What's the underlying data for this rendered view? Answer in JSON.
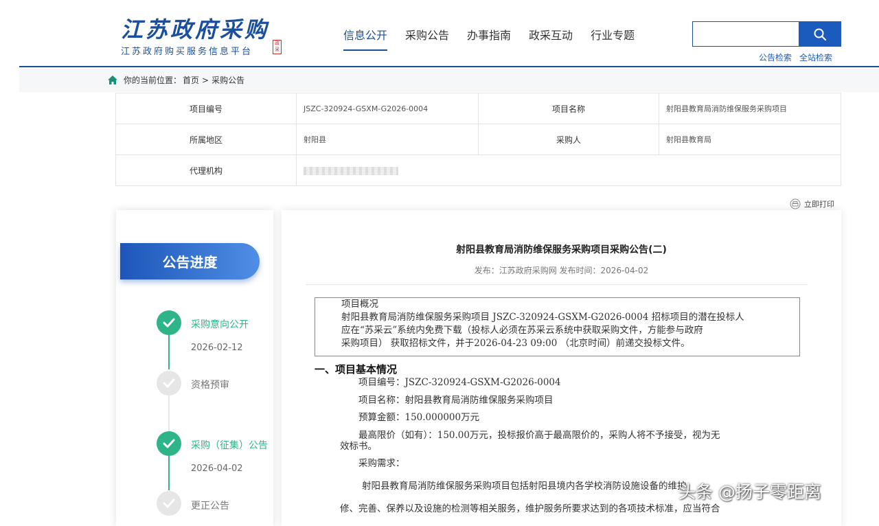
{
  "header": {
    "logo_calligraphy": "江苏政府采购",
    "logo_subtitle": "江苏政府购买服务信息平台",
    "logo_seal": "政采",
    "nav": [
      "信息公开",
      "采购公告",
      "办事指南",
      "政采互动",
      "行业专题"
    ],
    "search_placeholder": "",
    "search_links": [
      "公告检索",
      "全站检索"
    ]
  },
  "breadcrumb": {
    "prefix": "你的当前位置：",
    "home": "首页",
    "sep": ">",
    "current": "采购公告"
  },
  "info_table": {
    "project_no_label": "项目编号",
    "project_no": "JSZC-320924-GSXM-G2026-0004",
    "project_name_label": "项目名称",
    "project_name": "射阳县教育局消防维保服务采购项目",
    "region_label": "所属地区",
    "region": "射阳县",
    "buyer_label": "采购人",
    "buyer": "射阳县教育局",
    "agency_label": "代理机构"
  },
  "print_label": "立即打印",
  "sidebar": {
    "title": "公告进度",
    "steps": [
      {
        "label": "采购意向公开",
        "date": "2026-02-12",
        "status": "done"
      },
      {
        "label": "资格预审",
        "date": "",
        "status": "todo"
      },
      {
        "label": "采购（征集）公告",
        "date": "2026-04-02",
        "status": "done"
      },
      {
        "label": "更正公告",
        "date": "",
        "status": "todo"
      }
    ]
  },
  "document": {
    "title": "射阳县教育局消防维保服务采购项目采购公告(二)",
    "meta": "发布：江苏政府采购网   发布时间：2026-04-02",
    "overview_title": "项目概况",
    "overview_lines": [
      "射阳县教育局消防维保服务采购项目 JSZC-320924-GSXM-G2026-0004 招标项目的潜在投标人",
      "应在“苏采云”系统内免费下载（投标人必须在苏采云系统中获取采购文件，方能参与政府",
      "采购项目） 获取招标文件，并于2026-04-23 09:00 （北京时间）前递交投标文件。"
    ],
    "section1": "一、项目基本情况",
    "lines": [
      "项目编号：JSZC-320924-GSXM-G2026-0004",
      "项目名称：射阳县教育局消防维保服务采购项目",
      "预算金额：150.000000万元",
      "最高限价（如有）：150.00万元，投标报价高于最高限价的，采购人将不予接受，视为无",
      "效标书。",
      "采购需求：",
      "射阳县教育局消防维保服务采购项目包括射阳县境内各学校消防设施设备的维护",
      "修、完善、保养以及设施的检测等相关服务，维护服务所要求达到的各项技术标准，应当符合"
    ]
  },
  "watermark": "头条 @扬子零距离",
  "colors": {
    "brand": "#1b4f9c",
    "accent": "#1b5bbd",
    "success": "#2fb489"
  }
}
